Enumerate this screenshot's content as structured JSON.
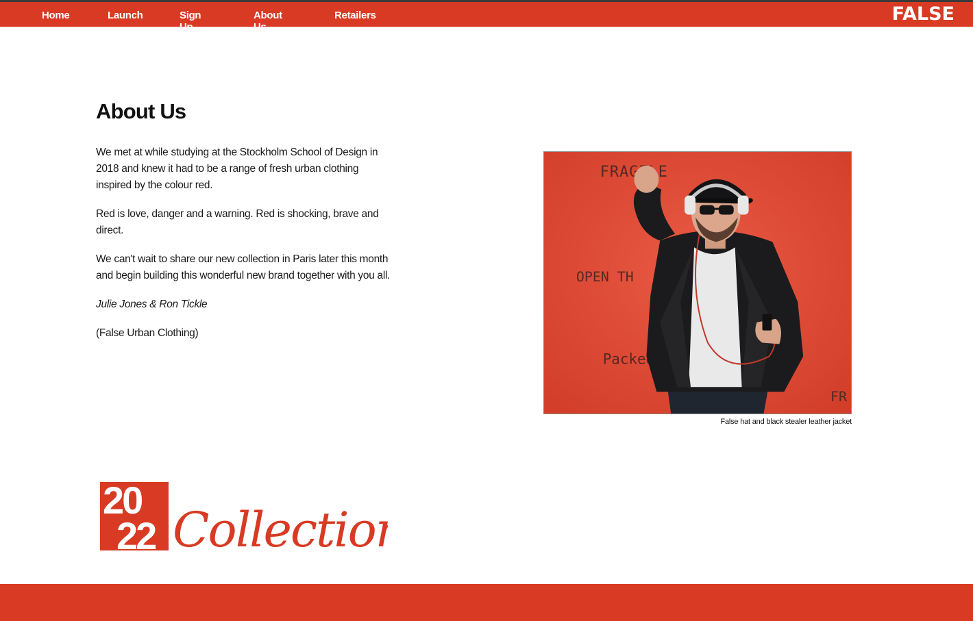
{
  "colors": {
    "accent": "#d83a23",
    "photo_background": "#e04a35"
  },
  "nav": {
    "items": [
      {
        "label": "Home"
      },
      {
        "label": "Launch"
      },
      {
        "label": "Sign Up"
      },
      {
        "label": "About Us"
      },
      {
        "label": "Retailers"
      }
    ],
    "brand": "FALSE"
  },
  "main": {
    "title": "About Us",
    "paragraphs": [
      "We met at while studying at the Stockholm School of Design in 2018 and knew it had to be a range of fresh urban clothing inspired by the colour red.",
      "Red is love, danger and a warning. Red is shocking, brave and direct.",
      "We can't wait to share our new collection in Paris later this month and begin building this wonderful new brand together with you all."
    ],
    "signature": "Julie Jones & Ron Tickle",
    "company": "(False Urban Clothing)"
  },
  "figure": {
    "caption": "False hat and black stealer leather jacket",
    "stencil_text": [
      "FRAGILE",
      "OPEN TH",
      "Packed",
      "FR"
    ]
  },
  "collection_logo": {
    "year_top": "20",
    "year_bottom": "22",
    "word": "Collection"
  }
}
